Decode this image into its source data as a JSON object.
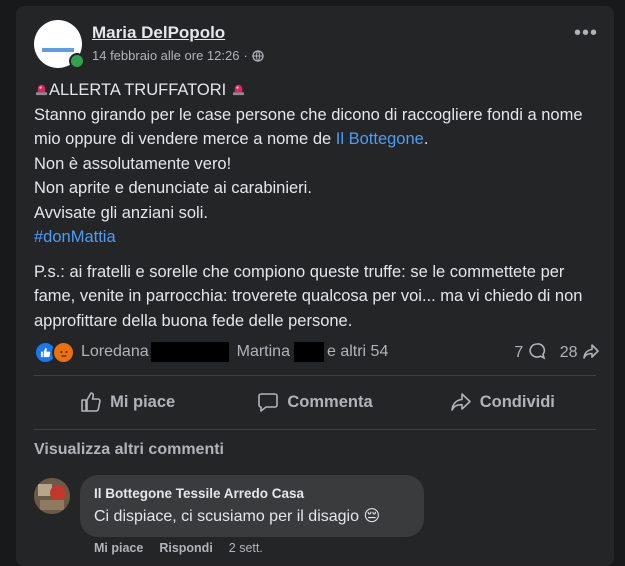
{
  "post": {
    "author": "Maria DelPopolo",
    "timestamp": "14 febbraio alle ore 12:26",
    "separator": "·",
    "privacy_icon": "globe-icon",
    "title": "ALLERTA TRUFFATORI",
    "title_icon": "police-siren-icon",
    "line1_prefix": "Stanno girando per le case persone che dicono di raccogliere fondi a nome mio oppure di vendere merce a nome de ",
    "line1_link": "Il Bottegone",
    "line1_suffix": ".",
    "line2": "Non è assolutamente vero!",
    "line3": "Non aprite e denunciate ai carabinieri.",
    "line4": "Avvisate gli anziani soli.",
    "hashtag": "#donMattia",
    "ps": "P.s.: ai fratelli e sorelle che compiono queste truffe: se le commettete per fame, venite in parrocchia: troverete qualcosa per voi... ma vi chiedo di non approfittare della buona fede delle persone."
  },
  "reactions": {
    "icons": [
      "like-icon",
      "angry-icon"
    ],
    "name1": "Loredana",
    "name2": "Martina",
    "others": "e altri 54",
    "comments_count": "7",
    "shares_count": "28"
  },
  "actions": {
    "like": "Mi piace",
    "comment": "Commenta",
    "share": "Condividi"
  },
  "comments": {
    "view_more": "Visualizza altri commenti",
    "item": {
      "author": "Il Bottegone Tessile Arredo Casa",
      "text": "Ci dispiace, ci scusiamo per il disagio 😔",
      "like": "Mi piace",
      "reply": "Rispondi",
      "time": "2 sett."
    }
  },
  "colors": {
    "background": "#18191a",
    "card": "#242526",
    "link": "#4b9ef7",
    "online": "#31a24c"
  }
}
